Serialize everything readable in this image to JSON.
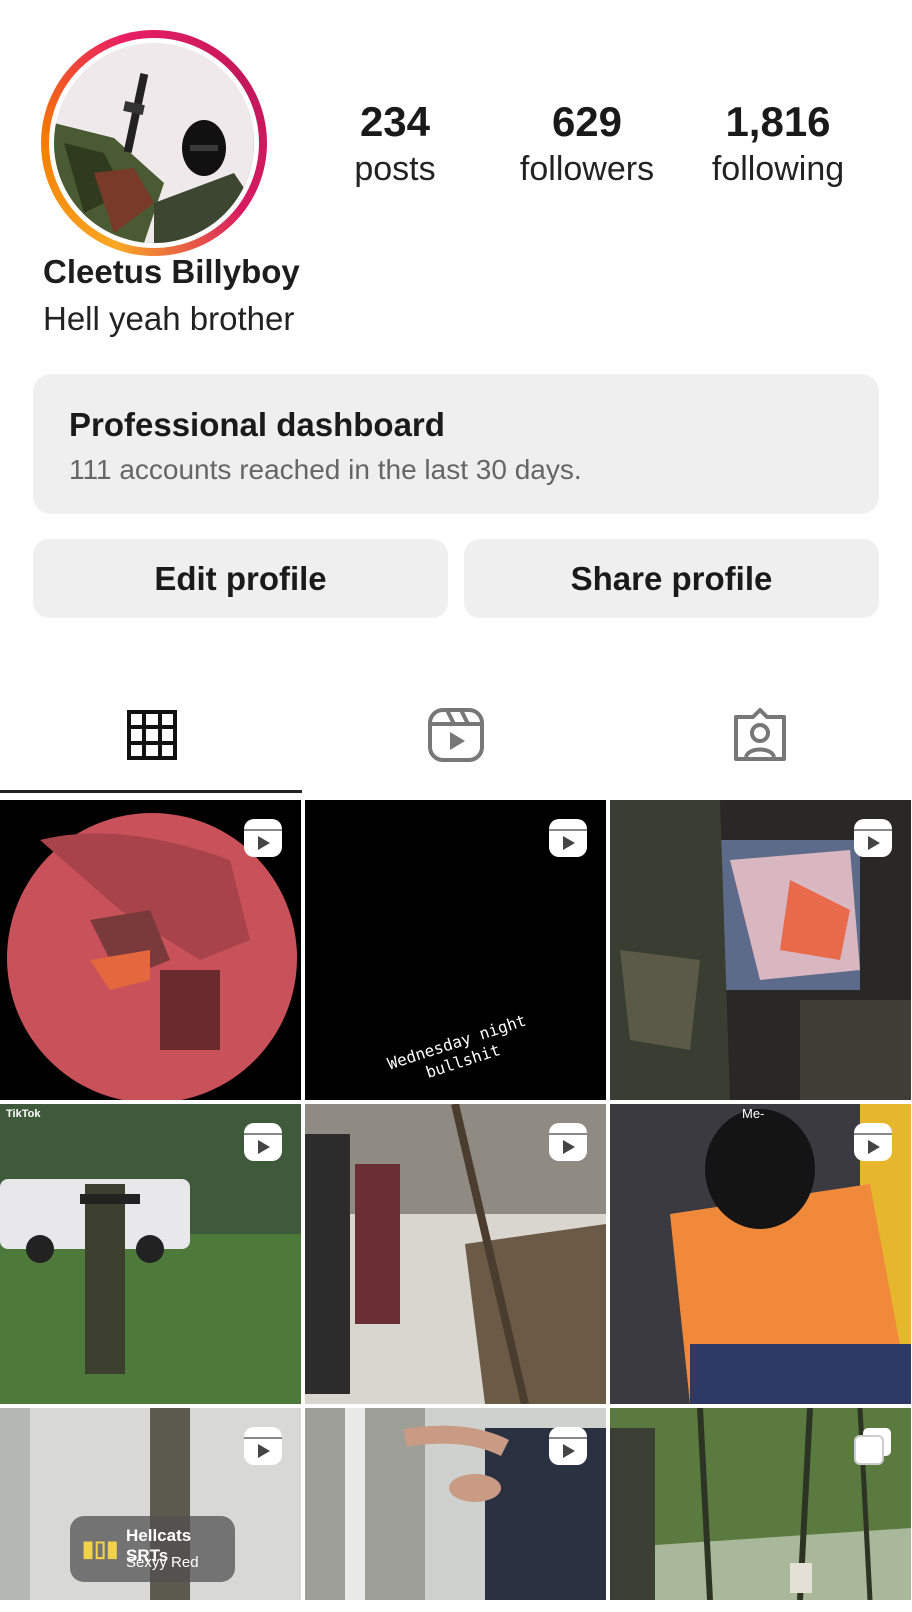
{
  "profile": {
    "name": "Cleetus Billyboy",
    "bio": "Hell yeah brother",
    "stats": [
      {
        "value": "234",
        "label": "posts"
      },
      {
        "value": "629",
        "label": "followers"
      },
      {
        "value": "1,816",
        "label": "following"
      }
    ]
  },
  "dashboard": {
    "title": "Professional dashboard",
    "subtitle": "111 accounts reached in the last 30 days."
  },
  "buttons": {
    "edit": "Edit profile",
    "share": "Share profile"
  },
  "tabs": [
    {
      "icon": "grid-icon",
      "selected": true
    },
    {
      "icon": "reels-icon",
      "selected": false
    },
    {
      "icon": "tagged-icon",
      "selected": false
    }
  ],
  "posts": [
    {
      "type": "reel",
      "caption": ""
    },
    {
      "type": "reel",
      "caption": "Wednesday night bullshit"
    },
    {
      "type": "reel",
      "caption": ""
    },
    {
      "type": "reel",
      "caption": "TikTok"
    },
    {
      "type": "reel",
      "caption": ""
    },
    {
      "type": "reel",
      "caption": "Me-"
    },
    {
      "type": "reel",
      "music_title": "Hellcats SRTs",
      "music_artist": "Sexyy Red"
    },
    {
      "type": "reel",
      "caption": ""
    },
    {
      "type": "carousel",
      "caption": ""
    }
  ]
}
